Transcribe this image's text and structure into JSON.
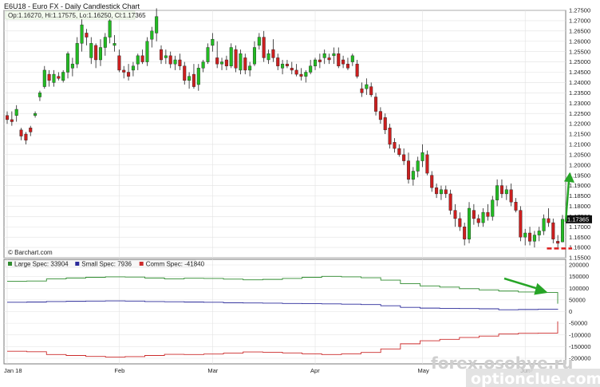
{
  "chart_title": "E6U18 - Euro FX - Daily Candlestick Chart",
  "ohlc_label": "Op:1.16270, Hi:1.17575, Lo:1.16250, Cl:1.17365",
  "credit": "© Barchart.com",
  "last_price": "1.17365",
  "watermark": {
    "primary": "forex.osobye.ru",
    "secondary": "optionclue.com"
  },
  "colors": {
    "up": "#22bb22",
    "down": "#cc1f1f",
    "large_spec": "#2e8b2e",
    "small_spec": "#2b2b9a",
    "comm_spec": "#cc2b2b",
    "arrow": "#27a527",
    "level": "#dd1c1c"
  },
  "chart_data": [
    {
      "type": "candlestick",
      "title": "E6U18 - Euro FX - Daily Candlestick Chart",
      "price_range": [
        1.155,
        1.275
      ],
      "y_ticks": [
        "1.15500",
        "1.16000",
        "1.16500",
        "1.17000",
        "1.17500",
        "1.18000",
        "1.18500",
        "1.19000",
        "1.19500",
        "1.20000",
        "1.20500",
        "1.21000",
        "1.21500",
        "1.22000",
        "1.22500",
        "1.23000",
        "1.23500",
        "1.24000",
        "1.24500",
        "1.25000",
        "1.25500",
        "1.26000",
        "1.26500",
        "1.27000",
        "1.27500"
      ],
      "x_ticks": [
        "Jan 18",
        "Feb",
        "Mar",
        "Apr",
        "May",
        "Jun"
      ],
      "x_tick_index": [
        0,
        24,
        44,
        66,
        89,
        111
      ],
      "candles": [
        [
          1.224,
          1.226,
          1.22,
          1.222
        ],
        [
          1.222,
          1.226,
          1.219,
          1.221
        ],
        [
          1.224,
          1.229,
          1.221,
          1.227
        ],
        [
          1.217,
          1.218,
          1.212,
          1.214
        ],
        [
          1.215,
          1.216,
          1.21,
          1.212
        ],
        [
          1.218,
          1.219,
          1.214,
          1.216
        ],
        [
          1.224,
          1.226,
          1.223,
          1.225
        ],
        [
          1.233,
          1.236,
          1.231,
          1.235
        ],
        [
          1.238,
          1.248,
          1.237,
          1.246
        ],
        [
          1.244,
          1.246,
          1.238,
          1.241
        ],
        [
          1.24,
          1.246,
          1.238,
          1.244
        ],
        [
          1.243,
          1.245,
          1.241,
          1.242
        ],
        [
          1.241,
          1.246,
          1.24,
          1.245
        ],
        [
          1.245,
          1.255,
          1.242,
          1.254
        ],
        [
          1.247,
          1.252,
          1.243,
          1.249
        ],
        [
          1.249,
          1.262,
          1.247,
          1.259
        ],
        [
          1.259,
          1.271,
          1.255,
          1.268
        ],
        [
          1.264,
          1.266,
          1.258,
          1.262
        ],
        [
          1.252,
          1.262,
          1.249,
          1.259
        ],
        [
          1.258,
          1.259,
          1.247,
          1.251
        ],
        [
          1.251,
          1.261,
          1.248,
          1.257
        ],
        [
          1.257,
          1.264,
          1.253,
          1.262
        ],
        [
          1.262,
          1.272,
          1.259,
          1.27
        ],
        [
          1.258,
          1.263,
          1.255,
          1.259
        ],
        [
          1.253,
          1.256,
          1.245,
          1.246
        ],
        [
          1.246,
          1.248,
          1.242,
          1.245
        ],
        [
          1.245,
          1.249,
          1.241,
          1.243
        ],
        [
          1.246,
          1.25,
          1.243,
          1.248
        ],
        [
          1.249,
          1.254,
          1.246,
          1.253
        ],
        [
          1.253,
          1.256,
          1.249,
          1.25
        ],
        [
          1.25,
          1.262,
          1.248,
          1.26
        ],
        [
          1.261,
          1.267,
          1.257,
          1.265
        ],
        [
          1.264,
          1.276,
          1.26,
          1.272
        ],
        [
          1.256,
          1.258,
          1.249,
          1.251
        ],
        [
          1.252,
          1.256,
          1.249,
          1.253
        ],
        [
          1.253,
          1.255,
          1.247,
          1.249
        ],
        [
          1.249,
          1.253,
          1.246,
          1.251
        ],
        [
          1.251,
          1.254,
          1.246,
          1.248
        ],
        [
          1.248,
          1.25,
          1.239,
          1.241
        ],
        [
          1.241,
          1.245,
          1.237,
          1.243
        ],
        [
          1.244,
          1.249,
          1.237,
          1.238
        ],
        [
          1.239,
          1.249,
          1.236,
          1.247
        ],
        [
          1.247,
          1.251,
          1.245,
          1.25
        ],
        [
          1.25,
          1.259,
          1.249,
          1.257
        ],
        [
          1.258,
          1.264,
          1.255,
          1.261
        ],
        [
          1.252,
          1.26,
          1.247,
          1.249
        ],
        [
          1.249,
          1.252,
          1.246,
          1.25
        ],
        [
          1.251,
          1.253,
          1.246,
          1.248
        ],
        [
          1.248,
          1.259,
          1.247,
          1.257
        ],
        [
          1.256,
          1.258,
          1.245,
          1.247
        ],
        [
          1.246,
          1.256,
          1.244,
          1.254
        ],
        [
          1.252,
          1.254,
          1.244,
          1.246
        ],
        [
          1.246,
          1.25,
          1.243,
          1.248
        ],
        [
          1.249,
          1.26,
          1.248,
          1.257
        ],
        [
          1.258,
          1.264,
          1.256,
          1.262
        ],
        [
          1.262,
          1.265,
          1.25,
          1.252
        ],
        [
          1.251,
          1.256,
          1.249,
          1.254
        ],
        [
          1.256,
          1.261,
          1.25,
          1.252
        ],
        [
          1.252,
          1.254,
          1.246,
          1.248
        ],
        [
          1.247,
          1.251,
          1.244,
          1.249
        ],
        [
          1.249,
          1.251,
          1.247,
          1.248
        ],
        [
          1.247,
          1.25,
          1.244,
          1.246
        ],
        [
          1.246,
          1.249,
          1.243,
          1.244
        ],
        [
          1.244,
          1.247,
          1.241,
          1.243
        ],
        [
          1.243,
          1.246,
          1.24,
          1.245
        ],
        [
          1.245,
          1.251,
          1.244,
          1.248
        ],
        [
          1.248,
          1.252,
          1.246,
          1.251
        ],
        [
          1.251,
          1.254,
          1.247,
          1.25
        ],
        [
          1.252,
          1.256,
          1.249,
          1.254
        ],
        [
          1.252,
          1.254,
          1.249,
          1.251
        ],
        [
          1.253,
          1.257,
          1.249,
          1.254
        ],
        [
          1.254,
          1.257,
          1.247,
          1.248
        ],
        [
          1.251,
          1.253,
          1.247,
          1.249
        ],
        [
          1.249,
          1.252,
          1.246,
          1.247
        ],
        [
          1.25,
          1.254,
          1.248,
          1.253
        ],
        [
          1.249,
          1.251,
          1.242,
          1.243
        ],
        [
          1.237,
          1.24,
          1.233,
          1.235
        ],
        [
          1.237,
          1.242,
          1.234,
          1.239
        ],
        [
          1.238,
          1.24,
          1.233,
          1.234
        ],
        [
          1.233,
          1.235,
          1.224,
          1.226
        ],
        [
          1.226,
          1.228,
          1.22,
          1.222
        ],
        [
          1.223,
          1.225,
          1.215,
          1.217
        ],
        [
          1.218,
          1.22,
          1.208,
          1.21
        ],
        [
          1.211,
          1.213,
          1.206,
          1.208
        ],
        [
          1.208,
          1.21,
          1.204,
          1.205
        ],
        [
          1.205,
          1.208,
          1.2,
          1.202
        ],
        [
          1.202,
          1.206,
          1.191,
          1.193
        ],
        [
          1.193,
          1.199,
          1.19,
          1.197
        ],
        [
          1.197,
          1.204,
          1.194,
          1.202
        ],
        [
          1.202,
          1.21,
          1.199,
          1.206
        ],
        [
          1.205,
          1.207,
          1.195,
          1.196
        ],
        [
          1.195,
          1.197,
          1.187,
          1.189
        ],
        [
          1.189,
          1.191,
          1.184,
          1.186
        ],
        [
          1.186,
          1.19,
          1.183,
          1.188
        ],
        [
          1.188,
          1.19,
          1.184,
          1.186
        ],
        [
          1.186,
          1.188,
          1.176,
          1.178
        ],
        [
          1.178,
          1.181,
          1.17,
          1.174
        ],
        [
          1.174,
          1.177,
          1.168,
          1.17
        ],
        [
          1.17,
          1.172,
          1.161,
          1.164
        ],
        [
          1.164,
          1.182,
          1.162,
          1.179
        ],
        [
          1.178,
          1.181,
          1.171,
          1.174
        ],
        [
          1.174,
          1.176,
          1.17,
          1.172
        ],
        [
          1.172,
          1.179,
          1.17,
          1.177
        ],
        [
          1.177,
          1.181,
          1.173,
          1.175
        ],
        [
          1.175,
          1.185,
          1.173,
          1.183
        ],
        [
          1.183,
          1.193,
          1.18,
          1.19
        ],
        [
          1.19,
          1.193,
          1.184,
          1.186
        ],
        [
          1.186,
          1.19,
          1.183,
          1.188
        ],
        [
          1.188,
          1.191,
          1.18,
          1.182
        ],
        [
          1.182,
          1.184,
          1.177,
          1.178
        ],
        [
          1.178,
          1.18,
          1.163,
          1.165
        ],
        [
          1.165,
          1.169,
          1.161,
          1.167
        ],
        [
          1.167,
          1.17,
          1.161,
          1.163
        ],
        [
          1.163,
          1.168,
          1.16,
          1.166
        ],
        [
          1.166,
          1.17,
          1.163,
          1.168
        ],
        [
          1.168,
          1.176,
          1.166,
          1.174
        ],
        [
          1.174,
          1.179,
          1.17,
          1.172
        ],
        [
          1.172,
          1.174,
          1.162,
          1.164
        ],
        [
          1.163,
          1.166,
          1.16,
          1.162
        ],
        [
          1.1627,
          1.17575,
          1.1625,
          1.17365
        ]
      ]
    },
    {
      "type": "line",
      "title": "COT positions",
      "range": [
        -200000,
        200000
      ],
      "y_ticks": [
        "200000",
        "150000",
        "100000",
        "50000",
        "0",
        "-50000",
        "-100000",
        "-150000",
        "-200000"
      ],
      "x_ticks": [
        "Jan 18",
        "Feb",
        "Mar",
        "Apr",
        "May",
        "Jun"
      ],
      "series": [
        {
          "name": "Large Spec: 33904",
          "color": "#2e8b2e",
          "values": [
            130000,
            131000,
            140000,
            144000,
            147000,
            149000,
            148000,
            144000,
            140000,
            143000,
            142000,
            139000,
            136000,
            138000,
            142000,
            147000,
            151000,
            149000,
            145000,
            135000,
            120000,
            110000,
            105000,
            98000,
            93000,
            88000,
            84000,
            82000,
            33904
          ]
        },
        {
          "name": "Small Spec: 7936",
          "color": "#2b2b9a",
          "values": [
            40000,
            41000,
            43000,
            44000,
            45000,
            46000,
            45000,
            43000,
            42000,
            41000,
            40000,
            38000,
            37000,
            36000,
            35000,
            34000,
            33000,
            32000,
            30000,
            25000,
            18000,
            15000,
            14000,
            13000,
            12000,
            8000,
            9000,
            10000,
            7936
          ]
        },
        {
          "name": "Comm Spec: -41840",
          "color": "#cc2b2b",
          "values": [
            -170000,
            -172000,
            -184000,
            -188000,
            -192000,
            -195000,
            -193000,
            -188000,
            -183000,
            -184000,
            -182000,
            -178000,
            -173000,
            -174000,
            -177000,
            -181000,
            -184000,
            -181000,
            -175000,
            -160000,
            -138000,
            -125000,
            -119000,
            -111000,
            -105000,
            -96000,
            -93000,
            -92000,
            -41840
          ]
        }
      ]
    }
  ]
}
